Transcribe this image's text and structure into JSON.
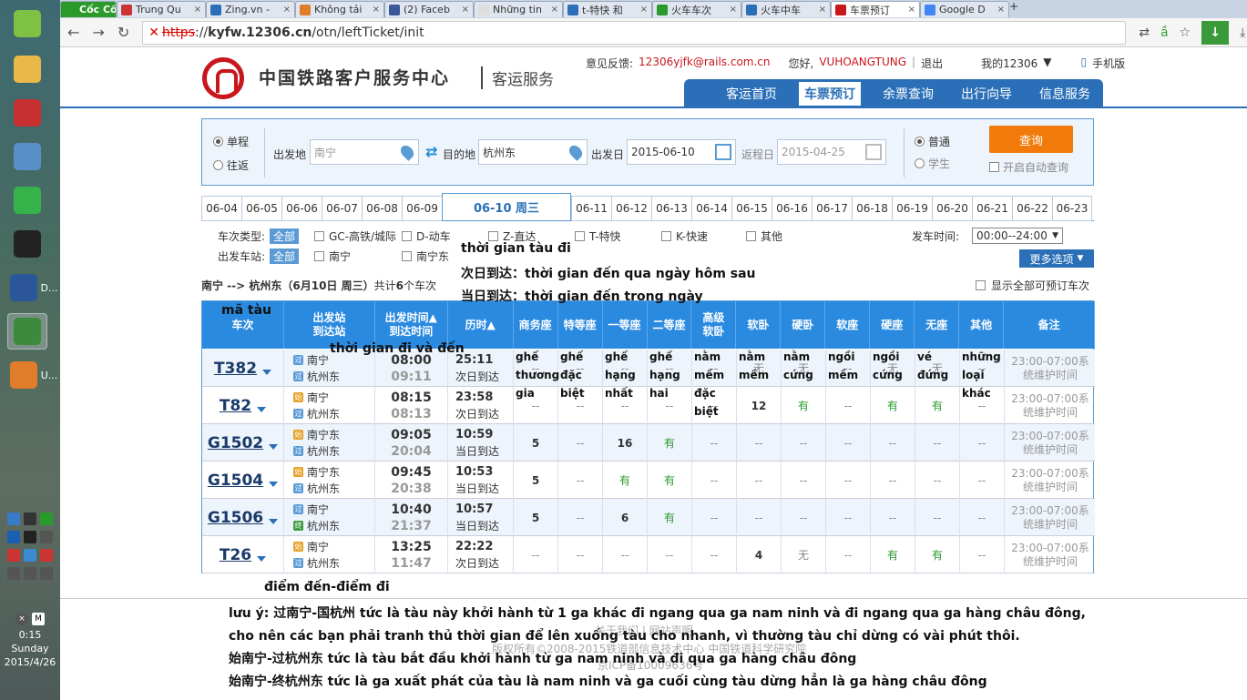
{
  "taskbar": {
    "apps": [
      {
        "label": "",
        "icon": "qq-browser-icon",
        "color": "#7dc242"
      },
      {
        "label": "",
        "icon": "folder-icon",
        "color": "#e8b84a"
      },
      {
        "label": "",
        "icon": "network-icon",
        "color": "#c63030"
      },
      {
        "label": "",
        "icon": "calculator-icon",
        "color": "#5b8fc7"
      },
      {
        "label": "",
        "icon": "wechat-icon",
        "color": "#36b24a"
      },
      {
        "label": "",
        "icon": "qq-icon",
        "color": "#222"
      },
      {
        "label": "D...",
        "icon": "word-icon",
        "color": "#2b579a"
      },
      {
        "label": "",
        "icon": "coccoc-icon",
        "color": "#3d8a3d"
      },
      {
        "label": "U...",
        "icon": "paint-icon",
        "color": "#e07c2a"
      }
    ],
    "clock_time": "0:15",
    "clock_day": "Sunday",
    "clock_date": "2015/4/26"
  },
  "browser": {
    "tabs": [
      "Cốc Cốc",
      "Trung Qu",
      "Zing.vn -",
      "Không tải",
      "(2) Faceb",
      "Những tin",
      "t-特快 和",
      "火车车次",
      "火车中车",
      "车票预订",
      "Google D"
    ],
    "url_prefix": "kyfw.12306.cn",
    "url_path": "/otn/leftTicket/init",
    "url_scheme": "https"
  },
  "header": {
    "title": "中国铁路客户服务中心",
    "subtitle": "客运服务",
    "feedback": "意见反馈:",
    "email": "12306yjfk@rails.com.cn",
    "hello": "您好,",
    "user": "VUHOANGTUNG",
    "logout": "退出",
    "my": "我的12306",
    "mobile": "手机版",
    "nav": [
      "客运首页",
      "车票预订",
      "余票查询",
      "出行向导",
      "信息服务"
    ]
  },
  "search": {
    "oneway": "单程",
    "round": "往返",
    "from_label": "出发地",
    "from": "南宁",
    "to_label": "目的地",
    "to": "杭州东",
    "date_label": "出发日",
    "date": "2015-06-10",
    "return_label": "返程日",
    "return_date": "2015-04-25",
    "normal": "普通",
    "student": "学生",
    "query": "查询",
    "auto": "开启自动查询"
  },
  "dates": [
    "06-04",
    "06-05",
    "06-06",
    "06-07",
    "06-08",
    "06-09",
    "06-10 周三",
    "06-11",
    "06-12",
    "06-13",
    "06-14",
    "06-15",
    "06-16",
    "06-17",
    "06-18",
    "06-19",
    "06-20",
    "06-21",
    "06-22",
    "06-23"
  ],
  "filter": {
    "type_label": "车次类型:",
    "all": "全部",
    "types": [
      "GC-高铁/城际",
      "D-动车",
      "Z-直达",
      "T-特快",
      "K-快速",
      "其他"
    ],
    "station_label": "出发车站:",
    "stations": [
      "南宁",
      "南宁东"
    ],
    "time_label": "发车时间:",
    "time": "00:00--24:00",
    "more": "更多选项"
  },
  "route": {
    "text": "南宁 --> 杭州东（6月10日  周三）",
    "count_pre": "共计",
    "count": "6",
    "count_post": "个车次",
    "show_all": "显示全部可预订车次"
  },
  "table": {
    "headers": [
      "车次",
      "出发站\n到达站",
      "出发时间▲\n到达时间",
      "历时▲",
      "商务座",
      "特等座",
      "一等座",
      "二等座",
      "高级\n软卧",
      "软卧",
      "硬卧",
      "软座",
      "硬座",
      "无座",
      "其他",
      "备注"
    ],
    "rows": [
      {
        "no": "T382",
        "from_b": "过",
        "from": "南宁",
        "to_b": "过",
        "to": "杭州东",
        "dep": "08:00",
        "arr": "09:11",
        "dur": "25:11",
        "day": "次日到达",
        "seats": [
          "--",
          "--",
          "--",
          "--",
          "--",
          "无",
          "无",
          "--",
          "无",
          "无",
          "--"
        ],
        "note1": "23:00-07:00系",
        "note2": "统维护时间"
      },
      {
        "no": "T82",
        "from_b": "始",
        "from": "南宁",
        "to_b": "过",
        "to": "杭州东",
        "dep": "08:15",
        "arr": "08:13",
        "dur": "23:58",
        "day": "次日到达",
        "seats": [
          "--",
          "--",
          "--",
          "--",
          "--",
          "12",
          "有",
          "--",
          "有",
          "有",
          "--"
        ],
        "note1": "23:00-07:00系",
        "note2": "统维护时间"
      },
      {
        "no": "G1502",
        "from_b": "始",
        "from": "南宁东",
        "to_b": "过",
        "to": "杭州东",
        "dep": "09:05",
        "arr": "20:04",
        "dur": "10:59",
        "day": "当日到达",
        "seats": [
          "5",
          "--",
          "16",
          "有",
          "--",
          "--",
          "--",
          "--",
          "--",
          "--",
          "--"
        ],
        "note1": "23:00-07:00系",
        "note2": "统维护时间"
      },
      {
        "no": "G1504",
        "from_b": "始",
        "from": "南宁东",
        "to_b": "过",
        "to": "杭州东",
        "dep": "09:45",
        "arr": "20:38",
        "dur": "10:53",
        "day": "当日到达",
        "seats": [
          "5",
          "--",
          "有",
          "有",
          "--",
          "--",
          "--",
          "--",
          "--",
          "--",
          "--"
        ],
        "note1": "23:00-07:00系",
        "note2": "统维护时间"
      },
      {
        "no": "G1506",
        "from_b": "过",
        "from": "南宁",
        "to_b": "终",
        "to": "杭州东",
        "dep": "10:40",
        "arr": "21:37",
        "dur": "10:57",
        "day": "当日到达",
        "seats": [
          "5",
          "--",
          "6",
          "有",
          "--",
          "--",
          "--",
          "--",
          "--",
          "--",
          "--"
        ],
        "note1": "23:00-07:00系",
        "note2": "统维护时间"
      },
      {
        "no": "T26",
        "from_b": "始",
        "from": "南宁",
        "to_b": "过",
        "to": "杭州东",
        "dep": "13:25",
        "arr": "11:47",
        "dur": "22:22",
        "day": "次日到达",
        "seats": [
          "--",
          "--",
          "--",
          "--",
          "--",
          "4",
          "无",
          "--",
          "有",
          "有",
          "--"
        ],
        "note1": "23:00-07:00系",
        "note2": "统维护时间"
      }
    ]
  },
  "annotations": {
    "ma_tau": "mã tàu",
    "tg_tau_di": "thời gian tàu đi",
    "next_day": "次日到达：thời gian đến qua ngày hôm sau",
    "same_day": "当日到达：thời gian đến trong ngày",
    "tg_di_den": "thời gian đi và đến",
    "seat_labels": [
      "ghế\nthương\ngia",
      "ghế\nđặc\nbiệt",
      "ghế\nhạng\nnhất",
      "ghế\nhạng\nhai",
      "nằm\nmềm\nđặc\nbiệt",
      "nằm\nmềm",
      "nằm\ncứng",
      "ngồi\nmềm",
      "ngồi\ncứng",
      "vé\nđứng",
      "những\nloại\nkhác"
    ],
    "diem": "điểm đến-điểm đi",
    "notes": [
      "lưu ý: 过南宁-国杭州 tức là tàu này khởi hành từ 1 ga khác đi ngang qua ga nam ninh và đi ngang qua ga hàng châu đông,",
      "cho nên các bạn phải tranh thủ thời gian để lên xuống tàu cho nhanh, vì thường tàu chỉ dừng có vài phút thôi.",
      "始南宁-过杭州东 tức là tàu bắt đầu khởi hành từ ga nam ninh và đi qua ga hàng châu đông",
      "始南宁-终杭州东 tức là ga xuất phát của tàu là nam ninh và ga cuối cùng tàu dừng hẳn là ga hàng châu đông"
    ]
  },
  "footer": {
    "links": "关于我们 | 网站声明",
    "copy": "版权所有©2008-2015铁道部信息技术中心  中国铁道科学研究院",
    "icp": "京ICP备10009636号"
  }
}
